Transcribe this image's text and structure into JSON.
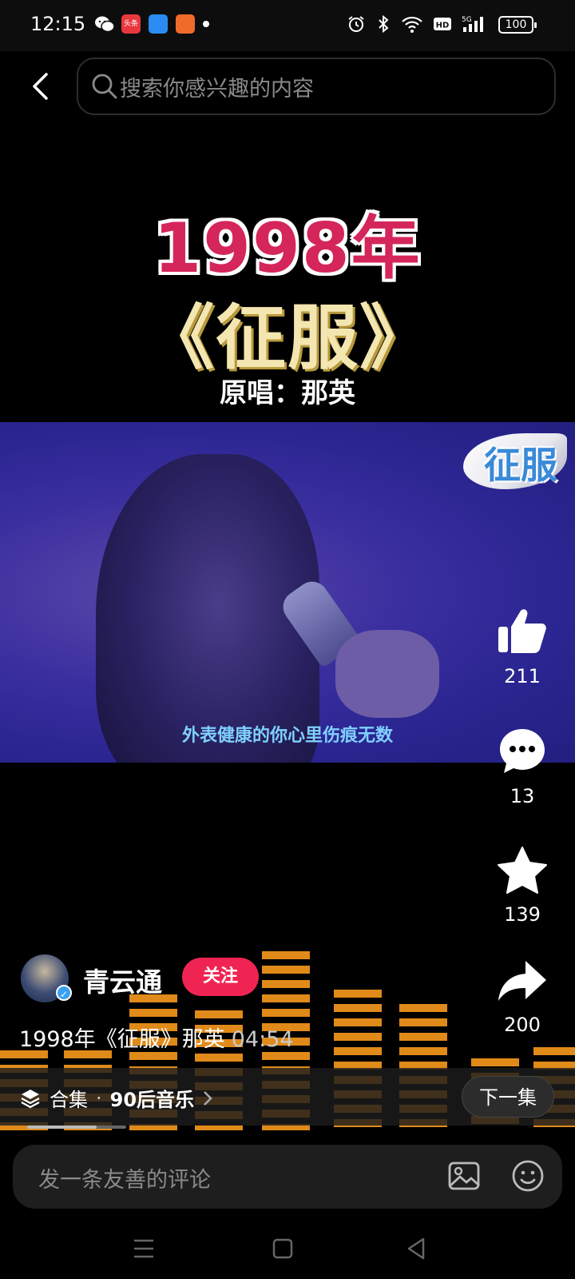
{
  "status_bar": {
    "time": "12:15",
    "notification_app_label": "头条",
    "battery": "100"
  },
  "search": {
    "placeholder": "搜索你感兴趣的内容"
  },
  "video": {
    "title_year": "1998年",
    "title_song": "《征服》",
    "title_singer": "原唱：那英",
    "badge": "征服",
    "subtitle": "外表健康的你心里伤痕无数"
  },
  "actions": {
    "likes": "211",
    "comments": "13",
    "favorites": "139",
    "shares": "200"
  },
  "author": {
    "name": "青云通",
    "follow_label": "关注"
  },
  "description": {
    "text": "1998年《征服》那英",
    "duration": "04:54"
  },
  "collection": {
    "label": "合集",
    "separator": "·",
    "name": "90后音乐",
    "next_label": "下一集",
    "progress": 0.7
  },
  "comment": {
    "placeholder": "发一条友善的评论"
  },
  "colors": {
    "accent": "#f02452",
    "equalizer": "#e08a1a",
    "subtitle": "#7fd0ff"
  }
}
